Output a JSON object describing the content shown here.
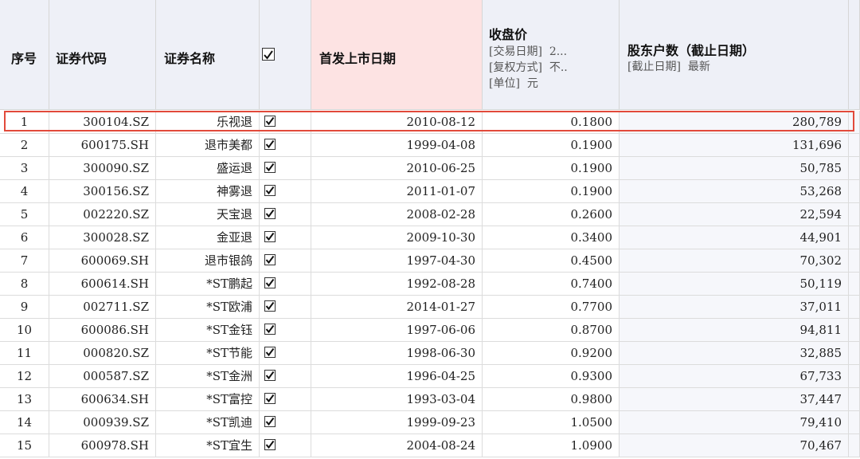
{
  "table": {
    "headers": {
      "seq": "序号",
      "code": "证券代码",
      "name": "证券名称",
      "listing_date": "首发上市日期",
      "close_price": {
        "title": "收盘价",
        "params": [
          "[交易日期]  2...",
          "[复权方式]  不..",
          "[单位]  元"
        ]
      },
      "holders": {
        "title": "股东户数（截止日期）",
        "params": [
          "[截止日期]  最新"
        ]
      }
    },
    "rows": [
      {
        "seq": "1",
        "code": "300104.SZ",
        "name": "乐视退",
        "date": "2010-08-12",
        "price": "0.1800",
        "holders": "280,789"
      },
      {
        "seq": "2",
        "code": "600175.SH",
        "name": "退市美都",
        "date": "1999-04-08",
        "price": "0.1900",
        "holders": "131,696"
      },
      {
        "seq": "3",
        "code": "300090.SZ",
        "name": "盛运退",
        "date": "2010-06-25",
        "price": "0.1900",
        "holders": "50,785"
      },
      {
        "seq": "4",
        "code": "300156.SZ",
        "name": "神雾退",
        "date": "2011-01-07",
        "price": "0.1900",
        "holders": "53,268"
      },
      {
        "seq": "5",
        "code": "002220.SZ",
        "name": "天宝退",
        "date": "2008-02-28",
        "price": "0.2600",
        "holders": "22,594"
      },
      {
        "seq": "6",
        "code": "300028.SZ",
        "name": "金亚退",
        "date": "2009-10-30",
        "price": "0.3400",
        "holders": "44,901"
      },
      {
        "seq": "7",
        "code": "600069.SH",
        "name": "退市银鸽",
        "date": "1997-04-30",
        "price": "0.4500",
        "holders": "70,302"
      },
      {
        "seq": "8",
        "code": "600614.SH",
        "name": "*ST鹏起",
        "date": "1992-08-28",
        "price": "0.7400",
        "holders": "50,119"
      },
      {
        "seq": "9",
        "code": "002711.SZ",
        "name": "*ST欧浦",
        "date": "2014-01-27",
        "price": "0.7700",
        "holders": "37,011"
      },
      {
        "seq": "10",
        "code": "600086.SH",
        "name": "*ST金钰",
        "date": "1997-06-06",
        "price": "0.8700",
        "holders": "94,811"
      },
      {
        "seq": "11",
        "code": "000820.SZ",
        "name": "*ST节能",
        "date": "1998-06-30",
        "price": "0.9200",
        "holders": "32,885"
      },
      {
        "seq": "12",
        "code": "000587.SZ",
        "name": "*ST金洲",
        "date": "1996-04-25",
        "price": "0.9300",
        "holders": "67,733"
      },
      {
        "seq": "13",
        "code": "600634.SH",
        "name": "*ST富控",
        "date": "1993-03-04",
        "price": "0.9800",
        "holders": "37,447"
      },
      {
        "seq": "14",
        "code": "000939.SZ",
        "name": "*ST凯迪",
        "date": "1999-09-23",
        "price": "1.0500",
        "holders": "79,410"
      },
      {
        "seq": "15",
        "code": "600978.SH",
        "name": "*ST宜生",
        "date": "2004-08-24",
        "price": "1.0900",
        "holders": "70,467"
      }
    ]
  },
  "colors": {
    "header_bg": "#eef0f7",
    "header_highlight": "#fde3e3",
    "row_highlight_border": "#e24a3b"
  }
}
